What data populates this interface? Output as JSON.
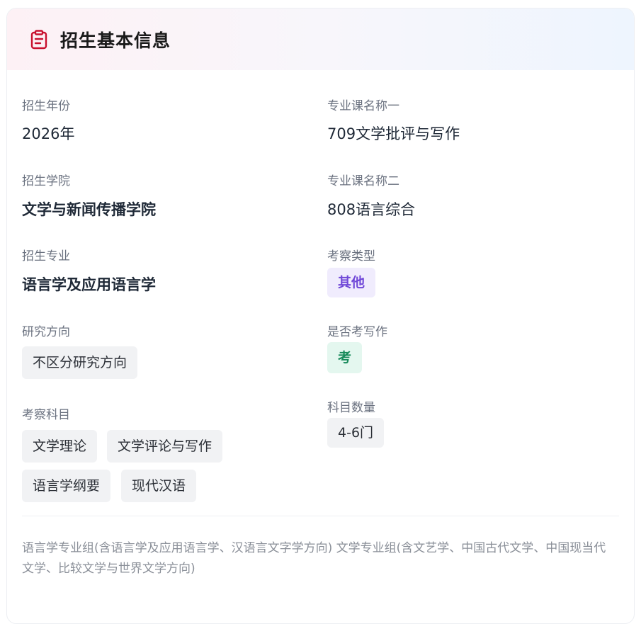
{
  "header": {
    "title": "招生基本信息",
    "icon": "clipboard-icon",
    "icon_color": "#c8102e"
  },
  "left": {
    "year": {
      "label": "招生年份",
      "value": "2026年"
    },
    "college": {
      "label": "招生学院",
      "value": "文学与新闻传播学院"
    },
    "major": {
      "label": "招生专业",
      "value": "语言学及应用语言学"
    },
    "direction": {
      "label": "研究方向",
      "tag": "不区分研究方向"
    },
    "subjects": {
      "label": "考察科目",
      "tags": [
        "文学理论",
        "文学评论与写作",
        "语言学纲要",
        "现代汉语"
      ]
    }
  },
  "right": {
    "course1": {
      "label": "专业课名称一",
      "value": "709文学批评与写作"
    },
    "course2": {
      "label": "专业课名称二",
      "value": "808语言综合"
    },
    "exam_type": {
      "label": "考察类型",
      "tag": "其他",
      "color": "#7048d8"
    },
    "writing": {
      "label": "是否考写作",
      "tag": "考",
      "color": "#178a5a"
    },
    "subject_count": {
      "label": "科目数量",
      "tag": "4-6门"
    }
  },
  "note": "语言学专业组(含语言学及应用语言学、汉语言文字学方向) 文学专业组(含文艺学、中国古代文学、中国现当代文学、比较文学与世界文学方向)"
}
